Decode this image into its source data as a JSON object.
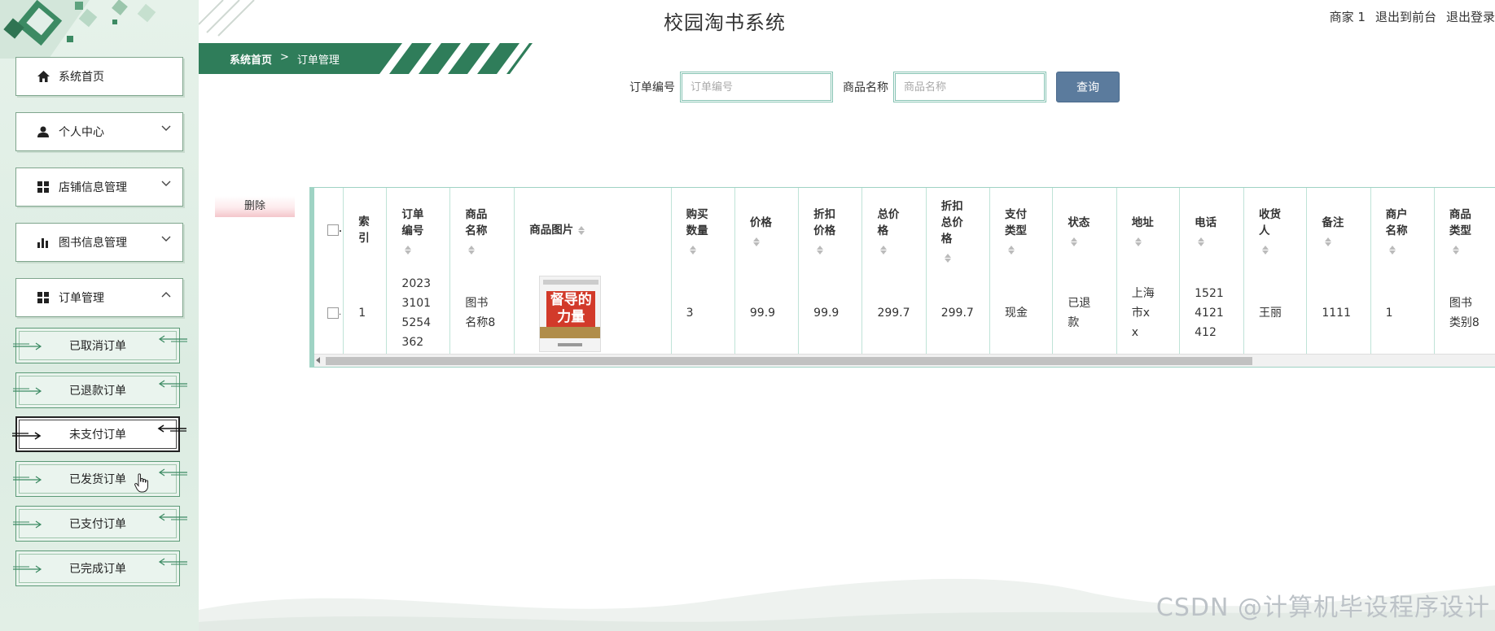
{
  "app": {
    "title": "校园淘书系统",
    "header_links": [
      "商家 1",
      "退出到前台",
      "退出登录"
    ]
  },
  "sidebar": {
    "menus": [
      {
        "label": "系统首页",
        "icon": "home-icon",
        "expandable": false
      },
      {
        "label": "个人中心",
        "icon": "user-icon",
        "expandable": true,
        "expanded": false
      },
      {
        "label": "店铺信息管理",
        "icon": "grid-icon",
        "expandable": true,
        "expanded": false
      },
      {
        "label": "图书信息管理",
        "icon": "bar-chart-icon",
        "expandable": true,
        "expanded": false
      },
      {
        "label": "订单管理",
        "icon": "grid-icon",
        "expandable": true,
        "expanded": true
      }
    ],
    "sub_items": [
      {
        "label": "已取消订单",
        "active": false
      },
      {
        "label": "已退款订单",
        "active": false
      },
      {
        "label": "未支付订单",
        "active": true
      },
      {
        "label": "已发货订单",
        "active": false
      },
      {
        "label": "已支付订单",
        "active": false
      },
      {
        "label": "已完成订单",
        "active": false
      }
    ]
  },
  "breadcrumb": {
    "home": "系统首页",
    "separator": ">",
    "current": "订单管理"
  },
  "search": {
    "order_no_label": "订单编号",
    "order_no_placeholder": "订单编号",
    "product_name_label": "商品名称",
    "product_name_placeholder": "商品名称",
    "query_button": "查询"
  },
  "actions": {
    "delete_button": "删除"
  },
  "table": {
    "headers": {
      "index": "索引",
      "order_no": "订单编号",
      "product_name": "商品名称",
      "product_image": "商品图片",
      "quantity": "购买数量",
      "price": "价格",
      "discount_price": "折扣价格",
      "total_price": "总价格",
      "discount_total": "折扣总价格",
      "pay_type": "支付类型",
      "status": "状态",
      "address": "地址",
      "phone": "电话",
      "receiver": "收货人",
      "note": "备注",
      "merchant_name": "商户名称",
      "product_type": "商品类型"
    },
    "rows": [
      {
        "index": "1",
        "order_no": "20233101 5254362",
        "product_name": "图书名称8",
        "product_image_text": "督导的力量",
        "quantity": "3",
        "price": "99.9",
        "discount_price": "99.9",
        "total_price": "299.7",
        "discount_total": "299.7",
        "pay_type": "现金",
        "status": "已退款",
        "address": "上海市xx",
        "phone": "15214121412",
        "receiver": "王丽",
        "note": "1111",
        "merchant_name": "1",
        "product_type": "图书类别8"
      }
    ]
  },
  "watermark": "CSDN @计算机毕设程序设计",
  "colors": {
    "accent_green": "#2e8b57",
    "query_button": "#5b7b9d",
    "sidebar_bg": "#e6f2ea",
    "table_border": "#9fd3c4"
  }
}
